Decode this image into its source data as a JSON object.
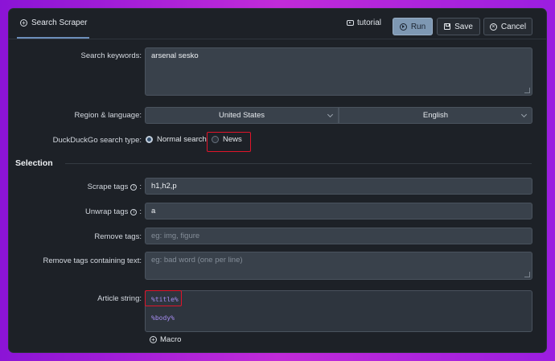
{
  "header": {
    "tab_label": "Search Scraper",
    "tutorial_label": "tutorial",
    "run_label": "Run",
    "save_label": "Save",
    "cancel_label": "Cancel"
  },
  "form": {
    "search_keywords": {
      "label": "Search keywords:",
      "value": "arsenal sesko"
    },
    "region": {
      "label": "Region & language:",
      "country": "United States",
      "language": "English"
    },
    "search_type": {
      "label": "DuckDuckGo search type:",
      "option_normal": "Normal search",
      "option_news": "News",
      "selected": "Normal search"
    }
  },
  "selection": {
    "title": "Selection",
    "scrape_tags": {
      "label": "Scrape tags",
      "value": "h1,h2,p"
    },
    "unwrap_tags": {
      "label": "Unwrap tags",
      "value": "a"
    },
    "remove_tags": {
      "label": "Remove tags:",
      "placeholder": "eg: img, figure"
    },
    "remove_text": {
      "label": "Remove tags containing text:",
      "placeholder": "eg: bad word (one per line)"
    },
    "article_string": {
      "label": "Article string:",
      "line1": "%title%",
      "line2": "%body%"
    },
    "macro_label": "Macro"
  },
  "icons": [
    "plus-circle-icon",
    "youtube-icon",
    "play-icon",
    "save-icon",
    "close-icon",
    "info-icon",
    "chevron-down-icon"
  ],
  "colors": {
    "accent": "#7e98b3",
    "highlight": "#e0142a",
    "macro_text": "#a58cf0"
  }
}
